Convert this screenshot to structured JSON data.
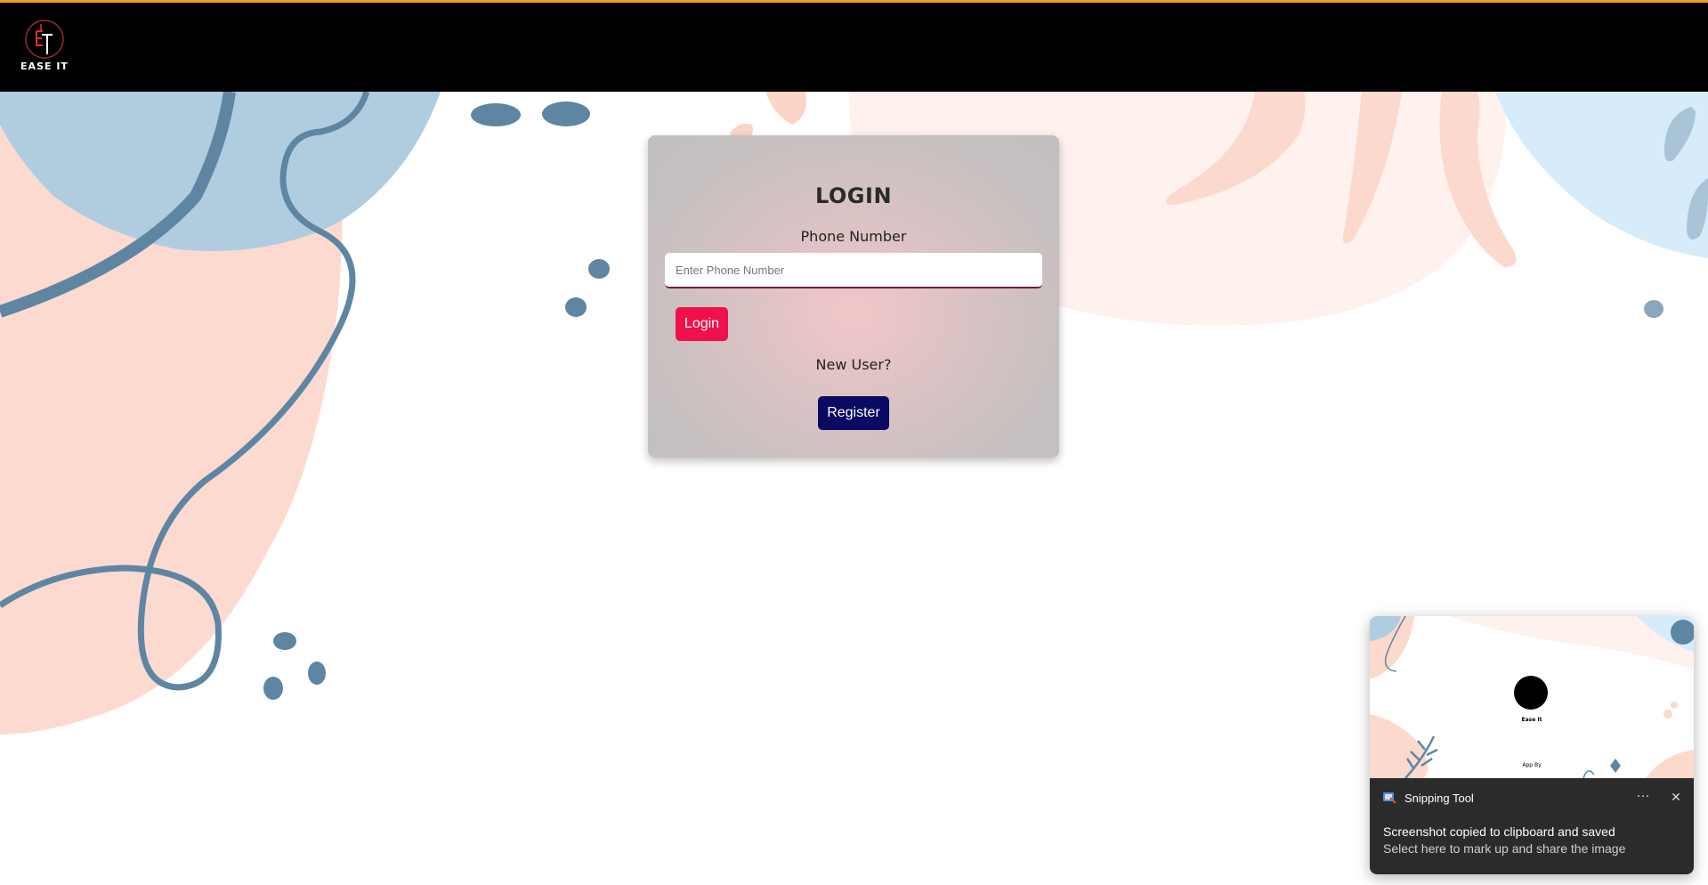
{
  "header": {
    "brand_name": "EASE IT",
    "accent_color": "#f39a1e",
    "background": "#000000"
  },
  "login": {
    "title": "LOGIN",
    "phone_label": "Phone Number",
    "phone_placeholder": "Enter Phone Number",
    "phone_value": "",
    "login_button": "Login",
    "new_user_text": "New User?",
    "register_button": "Register",
    "login_color": "#f0104b",
    "register_color": "#0b0a63"
  },
  "toast": {
    "app_name": "Snipping Tool",
    "more_label": "···",
    "close_label": "✕",
    "title": "Screenshot copied to clipboard and saved",
    "subtitle": "Select here to mark up and share the image",
    "preview": {
      "brand": "Ease It",
      "app_by": "App By"
    }
  },
  "icons": [
    "ease-it-logo",
    "snipping-tool-icon",
    "more-options-icon",
    "close-icon"
  ]
}
